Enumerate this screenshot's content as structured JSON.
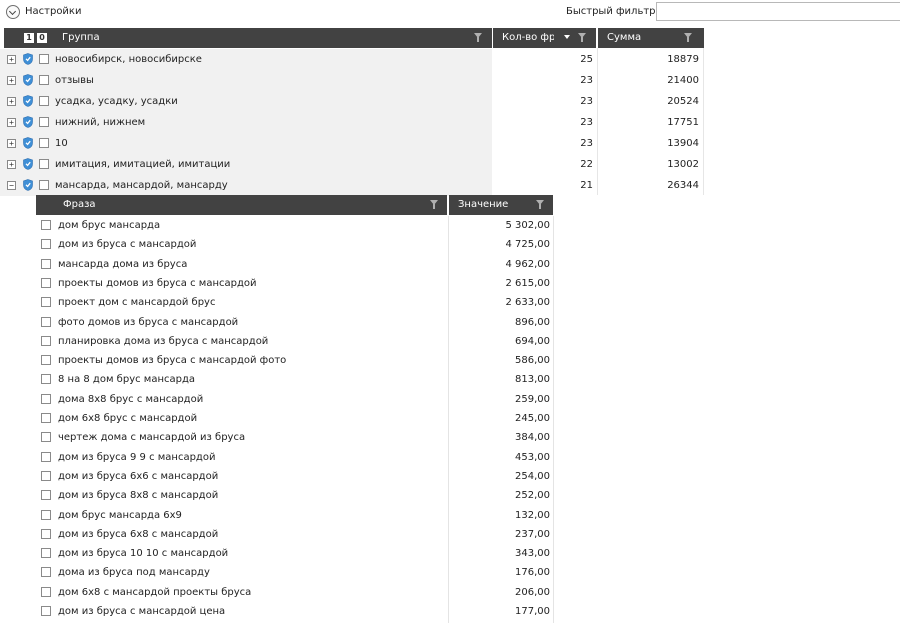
{
  "toolbar": {
    "settings_label": "Настройки",
    "quick_filter_label": "Быстрый фильтр:",
    "quick_filter_value": ""
  },
  "groups_grid": {
    "header_box_1": "1",
    "header_box_2": "0",
    "columns": {
      "group": "Группа",
      "count": "Кол-во фра",
      "sum": "Сумма"
    },
    "rows": [
      {
        "name": "новосибирск, новосибирске",
        "count": "25",
        "sum": "18879",
        "expander": "+"
      },
      {
        "name": "отзывы",
        "count": "23",
        "sum": "21400",
        "expander": "+"
      },
      {
        "name": "усадка, усадку, усадки",
        "count": "23",
        "sum": "20524",
        "expander": "+"
      },
      {
        "name": "нижний, нижнем",
        "count": "23",
        "sum": "17751",
        "expander": "+"
      },
      {
        "name": "10",
        "count": "23",
        "sum": "13904",
        "expander": "+"
      },
      {
        "name": "имитация, имитацией, имитации",
        "count": "22",
        "sum": "13002",
        "expander": "+"
      },
      {
        "name": "мансарда, мансардой, мансарду",
        "count": "21",
        "sum": "26344",
        "expander": "−"
      }
    ]
  },
  "phrases_grid": {
    "columns": {
      "phrase": "Фраза",
      "value": "Значение"
    },
    "rows": [
      {
        "phrase": "дом брус мансарда",
        "value": "5 302,00"
      },
      {
        "phrase": "дом из бруса с мансардой",
        "value": "4 725,00"
      },
      {
        "phrase": "мансарда дома из бруса",
        "value": "4 962,00"
      },
      {
        "phrase": "проекты домов из бруса с мансардой",
        "value": "2 615,00"
      },
      {
        "phrase": "проект дом с мансардой брус",
        "value": "2 633,00"
      },
      {
        "phrase": "фото домов из бруса с мансардой",
        "value": "896,00"
      },
      {
        "phrase": "планировка дома из бруса с мансардой",
        "value": "694,00"
      },
      {
        "phrase": "проекты домов из бруса с мансардой фото",
        "value": "586,00"
      },
      {
        "phrase": "8 на 8 дом брус мансарда",
        "value": "813,00"
      },
      {
        "phrase": "дома 8х8 брус с мансардой",
        "value": "259,00"
      },
      {
        "phrase": "дом 6х8 брус с мансардой",
        "value": "245,00"
      },
      {
        "phrase": "чертеж дома с мансардой из бруса",
        "value": "384,00"
      },
      {
        "phrase": "дом из бруса 9 9 с мансардой",
        "value": "453,00"
      },
      {
        "phrase": "дом из бруса 6х6 с мансардой",
        "value": "254,00"
      },
      {
        "phrase": "дом из бруса 8х8 с мансардой",
        "value": "252,00"
      },
      {
        "phrase": "дом брус мансарда 6х9",
        "value": "132,00"
      },
      {
        "phrase": "дом из бруса 6х8 с мансардой",
        "value": "237,00"
      },
      {
        "phrase": "дом из бруса 10 10 с мансардой",
        "value": "343,00"
      },
      {
        "phrase": "дома из бруса под мансарду",
        "value": "176,00"
      },
      {
        "phrase": "дом 6х8 с мансардой проекты бруса",
        "value": "206,00"
      },
      {
        "phrase": "дом из бруса с мансардой цена",
        "value": "177,00"
      }
    ]
  }
}
